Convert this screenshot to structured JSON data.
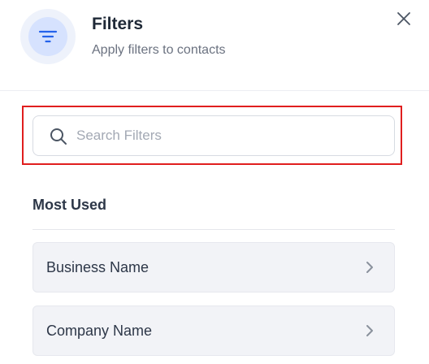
{
  "header": {
    "title": "Filters",
    "subtitle": "Apply filters to contacts",
    "icon": "filter-icon",
    "close_icon": "close-icon"
  },
  "search": {
    "placeholder": "Search Filters",
    "value": "",
    "icon": "search-icon"
  },
  "sections": [
    {
      "title": "Most Used",
      "items": [
        {
          "label": "Business Name",
          "icon": "chevron-right-icon"
        },
        {
          "label": "Company Name",
          "icon": "chevron-right-icon"
        }
      ]
    }
  ],
  "colors": {
    "accent": "#2563eb",
    "highlight": "#e01e1e",
    "item_background": "#f2f3f7"
  }
}
